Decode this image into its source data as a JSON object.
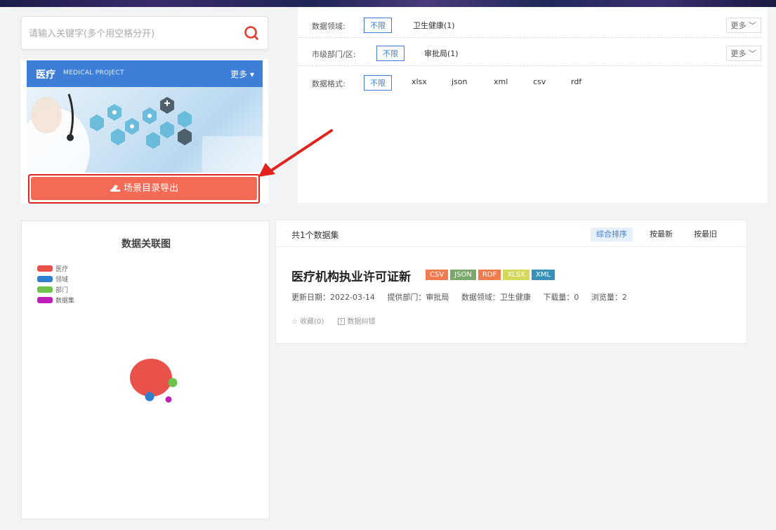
{
  "search": {
    "placeholder": "请输入关键字(多个用空格分开)"
  },
  "project": {
    "title": "医疗",
    "subtitle": "MEDICAL PROJECT",
    "more": "更多 ▾",
    "export_label": "场景目录导出"
  },
  "filters": {
    "domain": {
      "label": "数据领域:",
      "options": [
        "不限",
        "卫生健康(1)"
      ],
      "more": "更多 ﹀"
    },
    "dept": {
      "label": "市级部门/区:",
      "options": [
        "不限",
        "审批局(1)"
      ],
      "more": "更多 ﹀"
    },
    "format": {
      "label": "数据格式:",
      "options": [
        "不限",
        "xlsx",
        "json",
        "xml",
        "csv",
        "rdf"
      ]
    }
  },
  "graph": {
    "title": "数据关联图",
    "legend": [
      {
        "label": "医疗",
        "color": "#e9524a"
      },
      {
        "label": "领域",
        "color": "#2f7fd1"
      },
      {
        "label": "部门",
        "color": "#6cc24a"
      },
      {
        "label": "数据集",
        "color": "#c020b8"
      }
    ]
  },
  "results": {
    "count_text": "共1个数据集",
    "sort": [
      "综合排序",
      "按最新",
      "按最旧"
    ],
    "item": {
      "title": "医疗机构执业许可证新",
      "formats": [
        {
          "label": "CSV",
          "color": "#f07b4f"
        },
        {
          "label": "JSON",
          "color": "#7ba86b"
        },
        {
          "label": "RDF",
          "color": "#f07b4f"
        },
        {
          "label": "XLSX",
          "color": "#d4d95a"
        },
        {
          "label": "XML",
          "color": "#3a91b8"
        }
      ],
      "updated": "更新日期：2022-03-14",
      "provider": "提供部门：审批局",
      "domain": "数据领域：卫生健康",
      "downloads": "下载量：0",
      "views": "浏览量：2",
      "favorite": "☆ 收藏(0)",
      "report": "数据纠错"
    }
  }
}
